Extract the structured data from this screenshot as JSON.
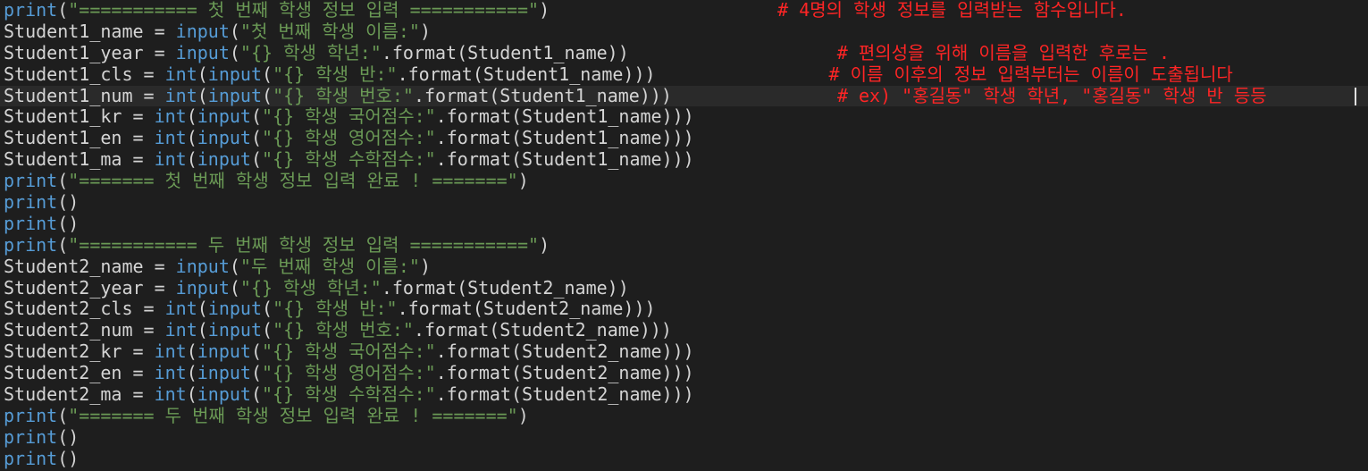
{
  "editor": {
    "language": "python",
    "colors": {
      "background": "#1e1e1e",
      "builtin": "#569cd6",
      "string": "#6a9955",
      "identifier": "#d4d4d4",
      "comment": "#ff2525"
    },
    "lines": [
      {
        "code": [
          [
            "kw",
            "print"
          ],
          [
            "id",
            "("
          ],
          [
            "str",
            "\"=========== 첫 번째 학생 정보 입력 ===========\""
          ],
          [
            "id",
            ")"
          ]
        ],
        "comment": "# 4명의 학생 정보를 입력받는 함수입니다."
      },
      {
        "code": [
          [
            "id",
            "Student1_name = "
          ],
          [
            "kw",
            "input"
          ],
          [
            "id",
            "("
          ],
          [
            "str",
            "\"첫 번째 학생 이름:\""
          ],
          [
            "id",
            ")"
          ]
        ]
      },
      {
        "code": [
          [
            "id",
            "Student1_year = "
          ],
          [
            "kw",
            "input"
          ],
          [
            "id",
            "("
          ],
          [
            "str",
            "\"{} 학생 학년:\""
          ],
          [
            "id",
            ".format(Student1_name))"
          ]
        ],
        "comment": "# 편의성을 위해 이름을 입력한 후로는 ."
      },
      {
        "code": [
          [
            "id",
            "Student1_cls = "
          ],
          [
            "kw",
            "int"
          ],
          [
            "id",
            "("
          ],
          [
            "kw",
            "input"
          ],
          [
            "id",
            "("
          ],
          [
            "str",
            "\"{} 학생 반:\""
          ],
          [
            "id",
            ".format(Student1_name)))"
          ]
        ],
        "comment": "# 이름 이후의 정보 입력부터는 이름이 도출됩니다"
      },
      {
        "code": [
          [
            "id",
            "Student1_num = "
          ],
          [
            "kw",
            "int"
          ],
          [
            "id",
            "("
          ],
          [
            "kw",
            "input"
          ],
          [
            "id",
            "("
          ],
          [
            "str",
            "\"{} 학생 번호:\""
          ],
          [
            "id",
            ".format(Student1_name)))"
          ]
        ],
        "comment": "# ex) \"홍길동\" 학생 학년, \"홍길동\" 학생 반 등등",
        "current": true
      },
      {
        "code": [
          [
            "id",
            "Student1_kr = "
          ],
          [
            "kw",
            "int"
          ],
          [
            "id",
            "("
          ],
          [
            "kw",
            "input"
          ],
          [
            "id",
            "("
          ],
          [
            "str",
            "\"{} 학생 국어점수:\""
          ],
          [
            "id",
            ".format(Student1_name)))"
          ]
        ]
      },
      {
        "code": [
          [
            "id",
            "Student1_en = "
          ],
          [
            "kw",
            "int"
          ],
          [
            "id",
            "("
          ],
          [
            "kw",
            "input"
          ],
          [
            "id",
            "("
          ],
          [
            "str",
            "\"{} 학생 영어점수:\""
          ],
          [
            "id",
            ".format(Student1_name)))"
          ]
        ]
      },
      {
        "code": [
          [
            "id",
            "Student1_ma = "
          ],
          [
            "kw",
            "int"
          ],
          [
            "id",
            "("
          ],
          [
            "kw",
            "input"
          ],
          [
            "id",
            "("
          ],
          [
            "str",
            "\"{} 학생 수학점수:\""
          ],
          [
            "id",
            ".format(Student1_name)))"
          ]
        ]
      },
      {
        "code": [
          [
            "kw",
            "print"
          ],
          [
            "id",
            "("
          ],
          [
            "str",
            "\"======= 첫 번째 학생 정보 입력 완료 ! =======\""
          ],
          [
            "id",
            ")"
          ]
        ]
      },
      {
        "code": [
          [
            "kw",
            "print"
          ],
          [
            "id",
            "()"
          ]
        ]
      },
      {
        "code": [
          [
            "kw",
            "print"
          ],
          [
            "id",
            "()"
          ]
        ]
      },
      {
        "code": [
          [
            "kw",
            "print"
          ],
          [
            "id",
            "("
          ],
          [
            "str",
            "\"=========== 두 번째 학생 정보 입력 ===========\""
          ],
          [
            "id",
            ")"
          ]
        ]
      },
      {
        "code": [
          [
            "id",
            "Student2_name = "
          ],
          [
            "kw",
            "input"
          ],
          [
            "id",
            "("
          ],
          [
            "str",
            "\"두 번째 학생 이름:\""
          ],
          [
            "id",
            ")"
          ]
        ]
      },
      {
        "code": [
          [
            "id",
            "Student2_year = "
          ],
          [
            "kw",
            "input"
          ],
          [
            "id",
            "("
          ],
          [
            "str",
            "\"{} 학생 학년:\""
          ],
          [
            "id",
            ".format(Student2_name))"
          ]
        ]
      },
      {
        "code": [
          [
            "id",
            "Student2_cls = "
          ],
          [
            "kw",
            "int"
          ],
          [
            "id",
            "("
          ],
          [
            "kw",
            "input"
          ],
          [
            "id",
            "("
          ],
          [
            "str",
            "\"{} 학생 반:\""
          ],
          [
            "id",
            ".format(Student2_name)))"
          ]
        ]
      },
      {
        "code": [
          [
            "id",
            "Student2_num = "
          ],
          [
            "kw",
            "int"
          ],
          [
            "id",
            "("
          ],
          [
            "kw",
            "input"
          ],
          [
            "id",
            "("
          ],
          [
            "str",
            "\"{} 학생 번호:\""
          ],
          [
            "id",
            ".format(Student2_name)))"
          ]
        ]
      },
      {
        "code": [
          [
            "id",
            "Student2_kr = "
          ],
          [
            "kw",
            "int"
          ],
          [
            "id",
            "("
          ],
          [
            "kw",
            "input"
          ],
          [
            "id",
            "("
          ],
          [
            "str",
            "\"{} 학생 국어점수:\""
          ],
          [
            "id",
            ".format(Student2_name)))"
          ]
        ]
      },
      {
        "code": [
          [
            "id",
            "Student2_en = "
          ],
          [
            "kw",
            "int"
          ],
          [
            "id",
            "("
          ],
          [
            "kw",
            "input"
          ],
          [
            "id",
            "("
          ],
          [
            "str",
            "\"{} 학생 영어점수:\""
          ],
          [
            "id",
            ".format(Student2_name)))"
          ]
        ]
      },
      {
        "code": [
          [
            "id",
            "Student2_ma = "
          ],
          [
            "kw",
            "int"
          ],
          [
            "id",
            "("
          ],
          [
            "kw",
            "input"
          ],
          [
            "id",
            "("
          ],
          [
            "str",
            "\"{} 학생 수학점수:\""
          ],
          [
            "id",
            ".format(Student2_name)))"
          ]
        ]
      },
      {
        "code": [
          [
            "kw",
            "print"
          ],
          [
            "id",
            "("
          ],
          [
            "str",
            "\"======= 두 번째 학생 정보 입력 완료 ! =======\""
          ],
          [
            "id",
            ")"
          ]
        ]
      },
      {
        "code": [
          [
            "kw",
            "print"
          ],
          [
            "id",
            "()"
          ]
        ]
      },
      {
        "code": [
          [
            "kw",
            "print"
          ],
          [
            "id",
            "()"
          ]
        ]
      }
    ]
  }
}
